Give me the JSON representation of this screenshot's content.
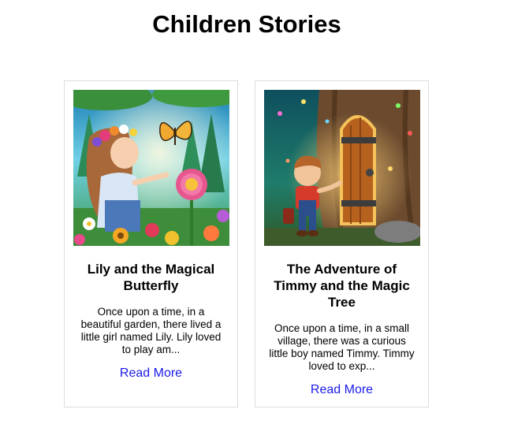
{
  "page": {
    "title": "Children Stories"
  },
  "stories": [
    {
      "title": "Lily and the Magical Butterfly",
      "excerpt": "Once upon a time, in a beautiful garden, there lived a little girl named Lily. Lily loved to play am...",
      "link_label": "Read More",
      "image_alt": "Girl with flower crown looking at a butterfly in a garden"
    },
    {
      "title": "The Adventure of Timmy and the Magic Tree",
      "excerpt": "Once upon a time, in a small village, there was a curious little boy named Timmy. Timmy loved to exp...",
      "link_label": "Read More",
      "image_alt": "Boy standing at a glowing door in a magic tree"
    }
  ],
  "colors": {
    "link": "#1a1ae6",
    "card_border": "#dddddd"
  }
}
